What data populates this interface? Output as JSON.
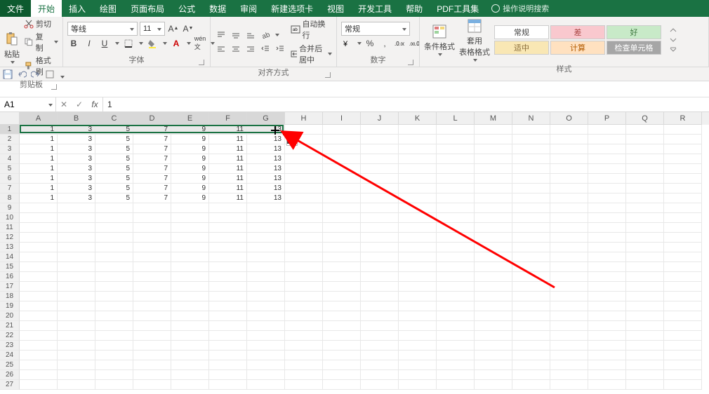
{
  "tabs": {
    "file": "文件",
    "home": "开始",
    "insert": "插入",
    "draw": "绘图",
    "layout": "页面布局",
    "formulas": "公式",
    "data": "数据",
    "review": "审阅",
    "newtab": "新建选项卡",
    "view": "视图",
    "dev": "开发工具",
    "help": "帮助",
    "pdf": "PDF工具集",
    "search_hint": "操作说明搜索"
  },
  "ribbon": {
    "clipboard": {
      "label": "剪贴板",
      "cut": "剪切",
      "copy": "复制",
      "paintfmt": "格式刷",
      "paste": "粘贴"
    },
    "font": {
      "label": "字体",
      "name": "等线",
      "size": "11",
      "bold": "B",
      "italic": "I",
      "underline": "U"
    },
    "align": {
      "label": "对齐方式",
      "wrap": "自动换行",
      "merge": "合并后居中"
    },
    "number": {
      "label": "数字",
      "format": "常规"
    },
    "styles": {
      "label": "样式",
      "cond": "条件格式",
      "tablefmt": "套用\n表格格式",
      "normal": "常规",
      "bad": "差",
      "good": "好",
      "neutral": "适中",
      "calc": "计算",
      "check": "检查单元格"
    }
  },
  "namebox": "A1",
  "formula": "1",
  "columns": [
    "A",
    "B",
    "C",
    "D",
    "E",
    "F",
    "G",
    "H",
    "I",
    "J",
    "K",
    "L",
    "M",
    "N",
    "O",
    "P",
    "Q",
    "R"
  ],
  "selected_cols": [
    "A",
    "B",
    "C",
    "D",
    "E",
    "F",
    "G"
  ],
  "data_rows": 8,
  "total_rows": 27,
  "row_values": [
    1,
    3,
    5,
    7,
    9,
    11,
    13
  ],
  "chart_data": {
    "type": "table",
    "columns": [
      "A",
      "B",
      "C",
      "D",
      "E",
      "F",
      "G"
    ],
    "rows": [
      [
        1,
        3,
        5,
        7,
        9,
        11,
        13
      ],
      [
        1,
        3,
        5,
        7,
        9,
        11,
        13
      ],
      [
        1,
        3,
        5,
        7,
        9,
        11,
        13
      ],
      [
        1,
        3,
        5,
        7,
        9,
        11,
        13
      ],
      [
        1,
        3,
        5,
        7,
        9,
        11,
        13
      ],
      [
        1,
        3,
        5,
        7,
        9,
        11,
        13
      ],
      [
        1,
        3,
        5,
        7,
        9,
        11,
        13
      ],
      [
        1,
        3,
        5,
        7,
        9,
        11,
        13
      ]
    ]
  }
}
